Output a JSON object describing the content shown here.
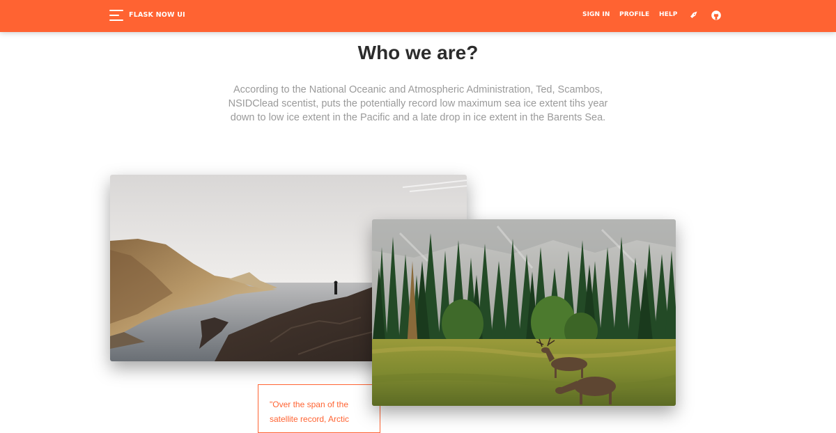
{
  "navbar": {
    "brand": "FLASK NOW UI",
    "links": {
      "signin": "SIGN IN",
      "profile": "PROFILE",
      "help": "HELP"
    },
    "icons": [
      "menu-icon",
      "rocket-icon",
      "github-icon"
    ],
    "color": "#ff6332"
  },
  "section": {
    "title": "Who we are?",
    "intro": "According to the National Oceanic and Atmospheric Administration, Ted, Scambos, NSIDClead scentist, puts the potentially record low maximum sea ice extent tihs year down to low ice extent in the Pacific and a late drop in ice extent in the Barents Sea."
  },
  "quote": {
    "text": "\"Over the span of the satellite record, Arctic"
  },
  "colors": {
    "accent": "#ff6332",
    "title": "#2c2c2c",
    "body_text": "#9a9a9a"
  }
}
